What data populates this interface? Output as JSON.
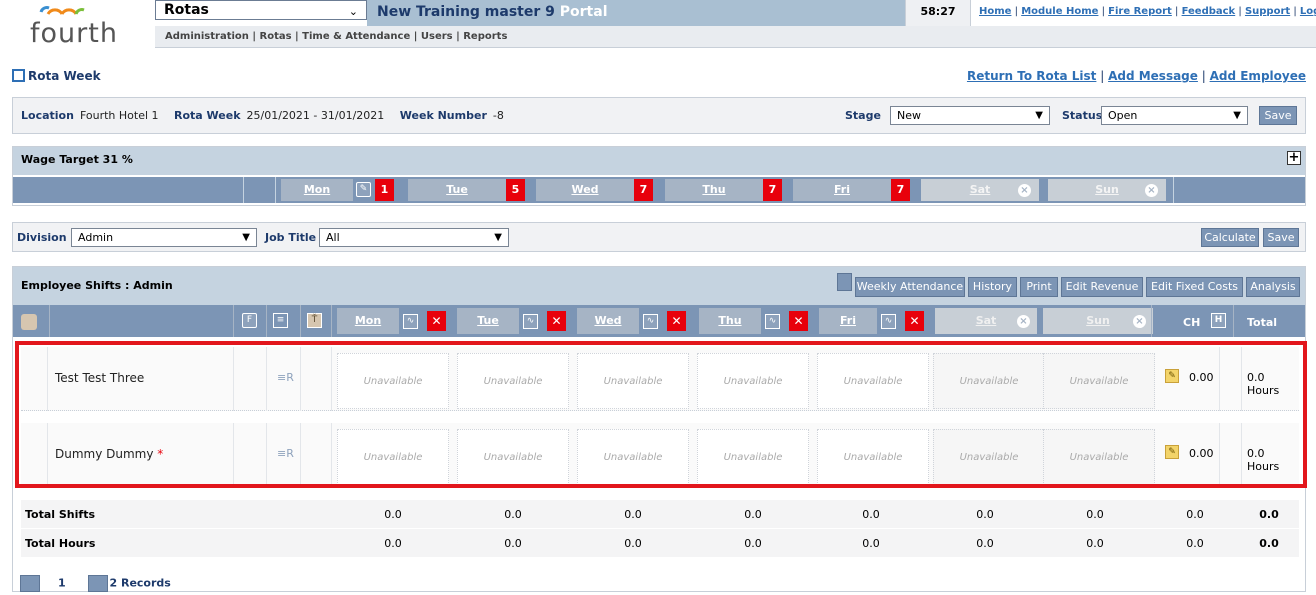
{
  "header": {
    "logo_text": "fourth",
    "module_select": "Rotas",
    "portal_name": "New Training master 9",
    "portal_suffix": "Portal",
    "timer": "58:27",
    "top_links": [
      "Home",
      "Module Home",
      "Fire Report",
      "Feedback",
      "Support",
      "Logo"
    ],
    "menu": "Administration | Rotas | Time & Attendance | Users | Reports"
  },
  "page": {
    "title": "Rota Week",
    "right_links": [
      "Return To Rota List",
      "Add Message",
      "Add Employee"
    ]
  },
  "location": {
    "location_label": "Location",
    "location_value": "Fourth Hotel 1",
    "week_label": "Rota Week",
    "week_value": "25/01/2021 - 31/01/2021",
    "weeknum_label": "Week Number",
    "weeknum_value": "-8",
    "stage_label": "Stage",
    "stage_value": "New",
    "status_label": "Status",
    "status_value": "Open",
    "save_label": "Save"
  },
  "wage": {
    "title": "Wage Target 31 %",
    "plus": "+",
    "days": [
      {
        "label": "Mon",
        "badge": "1"
      },
      {
        "label": "Tue",
        "badge": "5"
      },
      {
        "label": "Wed",
        "badge": "7"
      },
      {
        "label": "Thu",
        "badge": "7"
      },
      {
        "label": "Fri",
        "badge": "7"
      },
      {
        "label": "Sat",
        "badge": ""
      },
      {
        "label": "Sun",
        "badge": ""
      }
    ],
    "closed_glyph": "×"
  },
  "division": {
    "division_label": "Division",
    "division_value": "Admin",
    "job_label": "Job Title",
    "job_value": "All",
    "calculate_label": "Calculate",
    "save_label": "Save"
  },
  "shifts": {
    "title": "Employee Shifts : Admin",
    "buttons": [
      "Weekly Attendance",
      "History",
      "Print",
      "Edit Revenue",
      "Edit Fixed Costs",
      "Analysis"
    ],
    "col_f": "F",
    "col_days": [
      "Mon",
      "Tue",
      "Wed",
      "Thu",
      "Fri",
      "Sat",
      "Sun"
    ],
    "col_ch": "CH",
    "col_h": "H",
    "col_total": "Total",
    "close_glyph": "✕",
    "employees": [
      {
        "name": "Test Test Three",
        "required": "",
        "ch": "0.00",
        "total": "0.0 Hours"
      },
      {
        "name": "Dummy Dummy",
        "required": "*",
        "ch": "0.00",
        "total": "0.0 Hours"
      }
    ],
    "unavailable_label": "Unavailable",
    "totals": [
      {
        "label": "Total Shifts",
        "values": [
          "0.0",
          "0.0",
          "0.0",
          "0.0",
          "0.0",
          "0.0",
          "0.0"
        ],
        "ch": "0.0",
        "total": "0.0"
      },
      {
        "label": "Total Hours",
        "values": [
          "0.0",
          "0.0",
          "0.0",
          "0.0",
          "0.0",
          "0.0",
          "0.0"
        ],
        "ch": "0.0",
        "total": "0.0"
      }
    ]
  },
  "pager": {
    "page": "1",
    "records": "2 Records"
  }
}
